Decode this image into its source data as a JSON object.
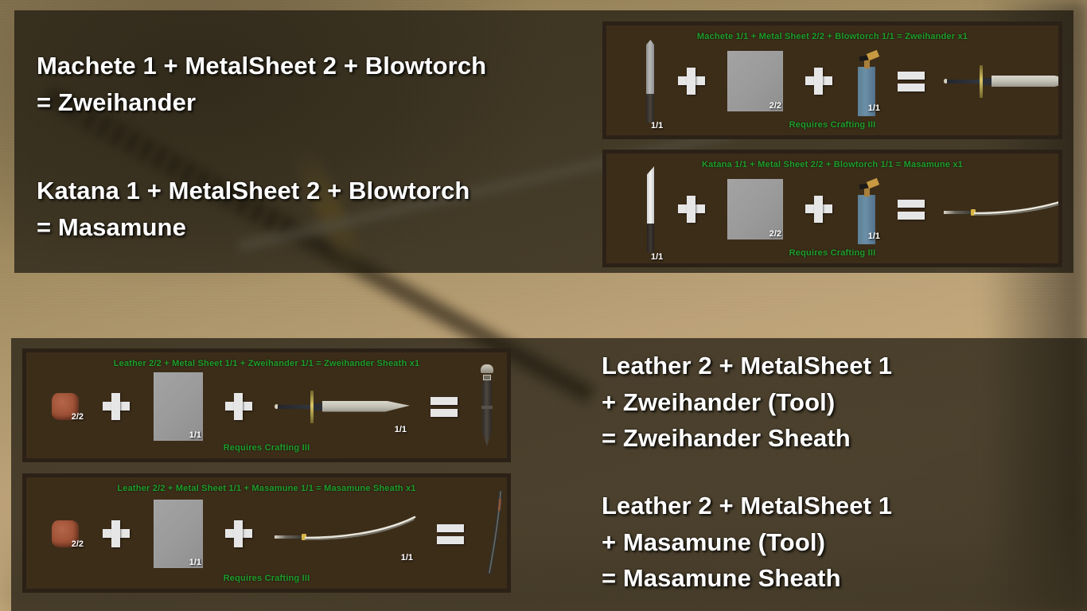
{
  "captions": {
    "zweihander": "Machete 1 + MetalSheet 2 + Blowtorch\n = Zweihander",
    "masamune": "Katana 1 + MetalSheet 2 + Blowtorch\n = Masamune",
    "zweihander_sheath": "Leather 2 + MetalSheet 1\n + Zweihander (Tool)\n = Zweihander Sheath",
    "masamune_sheath": "Leather 2 + MetalSheet 1\n + Masamune (Tool)\n = Masamune Sheath"
  },
  "colors": {
    "recipe_text_green": "#1f9e2b",
    "panel_background": "#3c2d19",
    "panel_border": "#2b2117",
    "overlay": "rgba(28,23,14,0.72)",
    "caption_text": "#ffffff",
    "count_text": "#ffffff",
    "metal_sheet": "#9a9a9a",
    "leather": "#9c4f33",
    "blowtorch_body": "#6b8fa6",
    "sword_guard_gold": "#d8c664"
  },
  "panels": [
    {
      "id": "zweihander",
      "title": "Machete 1/1 + Metal Sheet 2/2 + Blowtorch 1/1 = Zweihander x1",
      "requirement": "Requires Crafting III",
      "ingredients": [
        {
          "name": "machete",
          "count": "1/1"
        },
        {
          "name": "metal-sheet",
          "count": "2/2"
        },
        {
          "name": "blowtorch",
          "count": "1/1"
        }
      ],
      "operators": {
        "plus": "+",
        "equals": "="
      },
      "result": {
        "name": "zweihander",
        "count": "x1"
      }
    },
    {
      "id": "masamune",
      "title": "Katana 1/1 + Metal Sheet 2/2 + Blowtorch 1/1 = Masamune x1",
      "requirement": "Requires Crafting III",
      "ingredients": [
        {
          "name": "katana",
          "count": "1/1"
        },
        {
          "name": "metal-sheet",
          "count": "2/2"
        },
        {
          "name": "blowtorch",
          "count": "1/1"
        }
      ],
      "operators": {
        "plus": "+",
        "equals": "="
      },
      "result": {
        "name": "masamune",
        "count": "x1"
      }
    },
    {
      "id": "zweihander-sheath",
      "title": "Leather 2/2 + Metal Sheet 1/1 + Zweihander 1/1 = Zweihander Sheath x1",
      "requirement": "Requires Crafting III",
      "ingredients": [
        {
          "name": "leather",
          "count": "2/2"
        },
        {
          "name": "metal-sheet",
          "count": "1/1"
        },
        {
          "name": "zweihander",
          "count": "1/1"
        }
      ],
      "operators": {
        "plus": "+",
        "equals": "="
      },
      "result": {
        "name": "zweihander-sheath",
        "count": "x1"
      }
    },
    {
      "id": "masamune-sheath",
      "title": "Leather 2/2 + Metal Sheet 1/1 + Masamune 1/1 = Masamune Sheath x1",
      "requirement": "Requires Crafting III",
      "ingredients": [
        {
          "name": "leather",
          "count": "2/2"
        },
        {
          "name": "metal-sheet",
          "count": "1/1"
        },
        {
          "name": "masamune",
          "count": "1/1"
        }
      ],
      "operators": {
        "plus": "+",
        "equals": "="
      },
      "result": {
        "name": "masamune-sheath",
        "count": "x1"
      }
    }
  ]
}
